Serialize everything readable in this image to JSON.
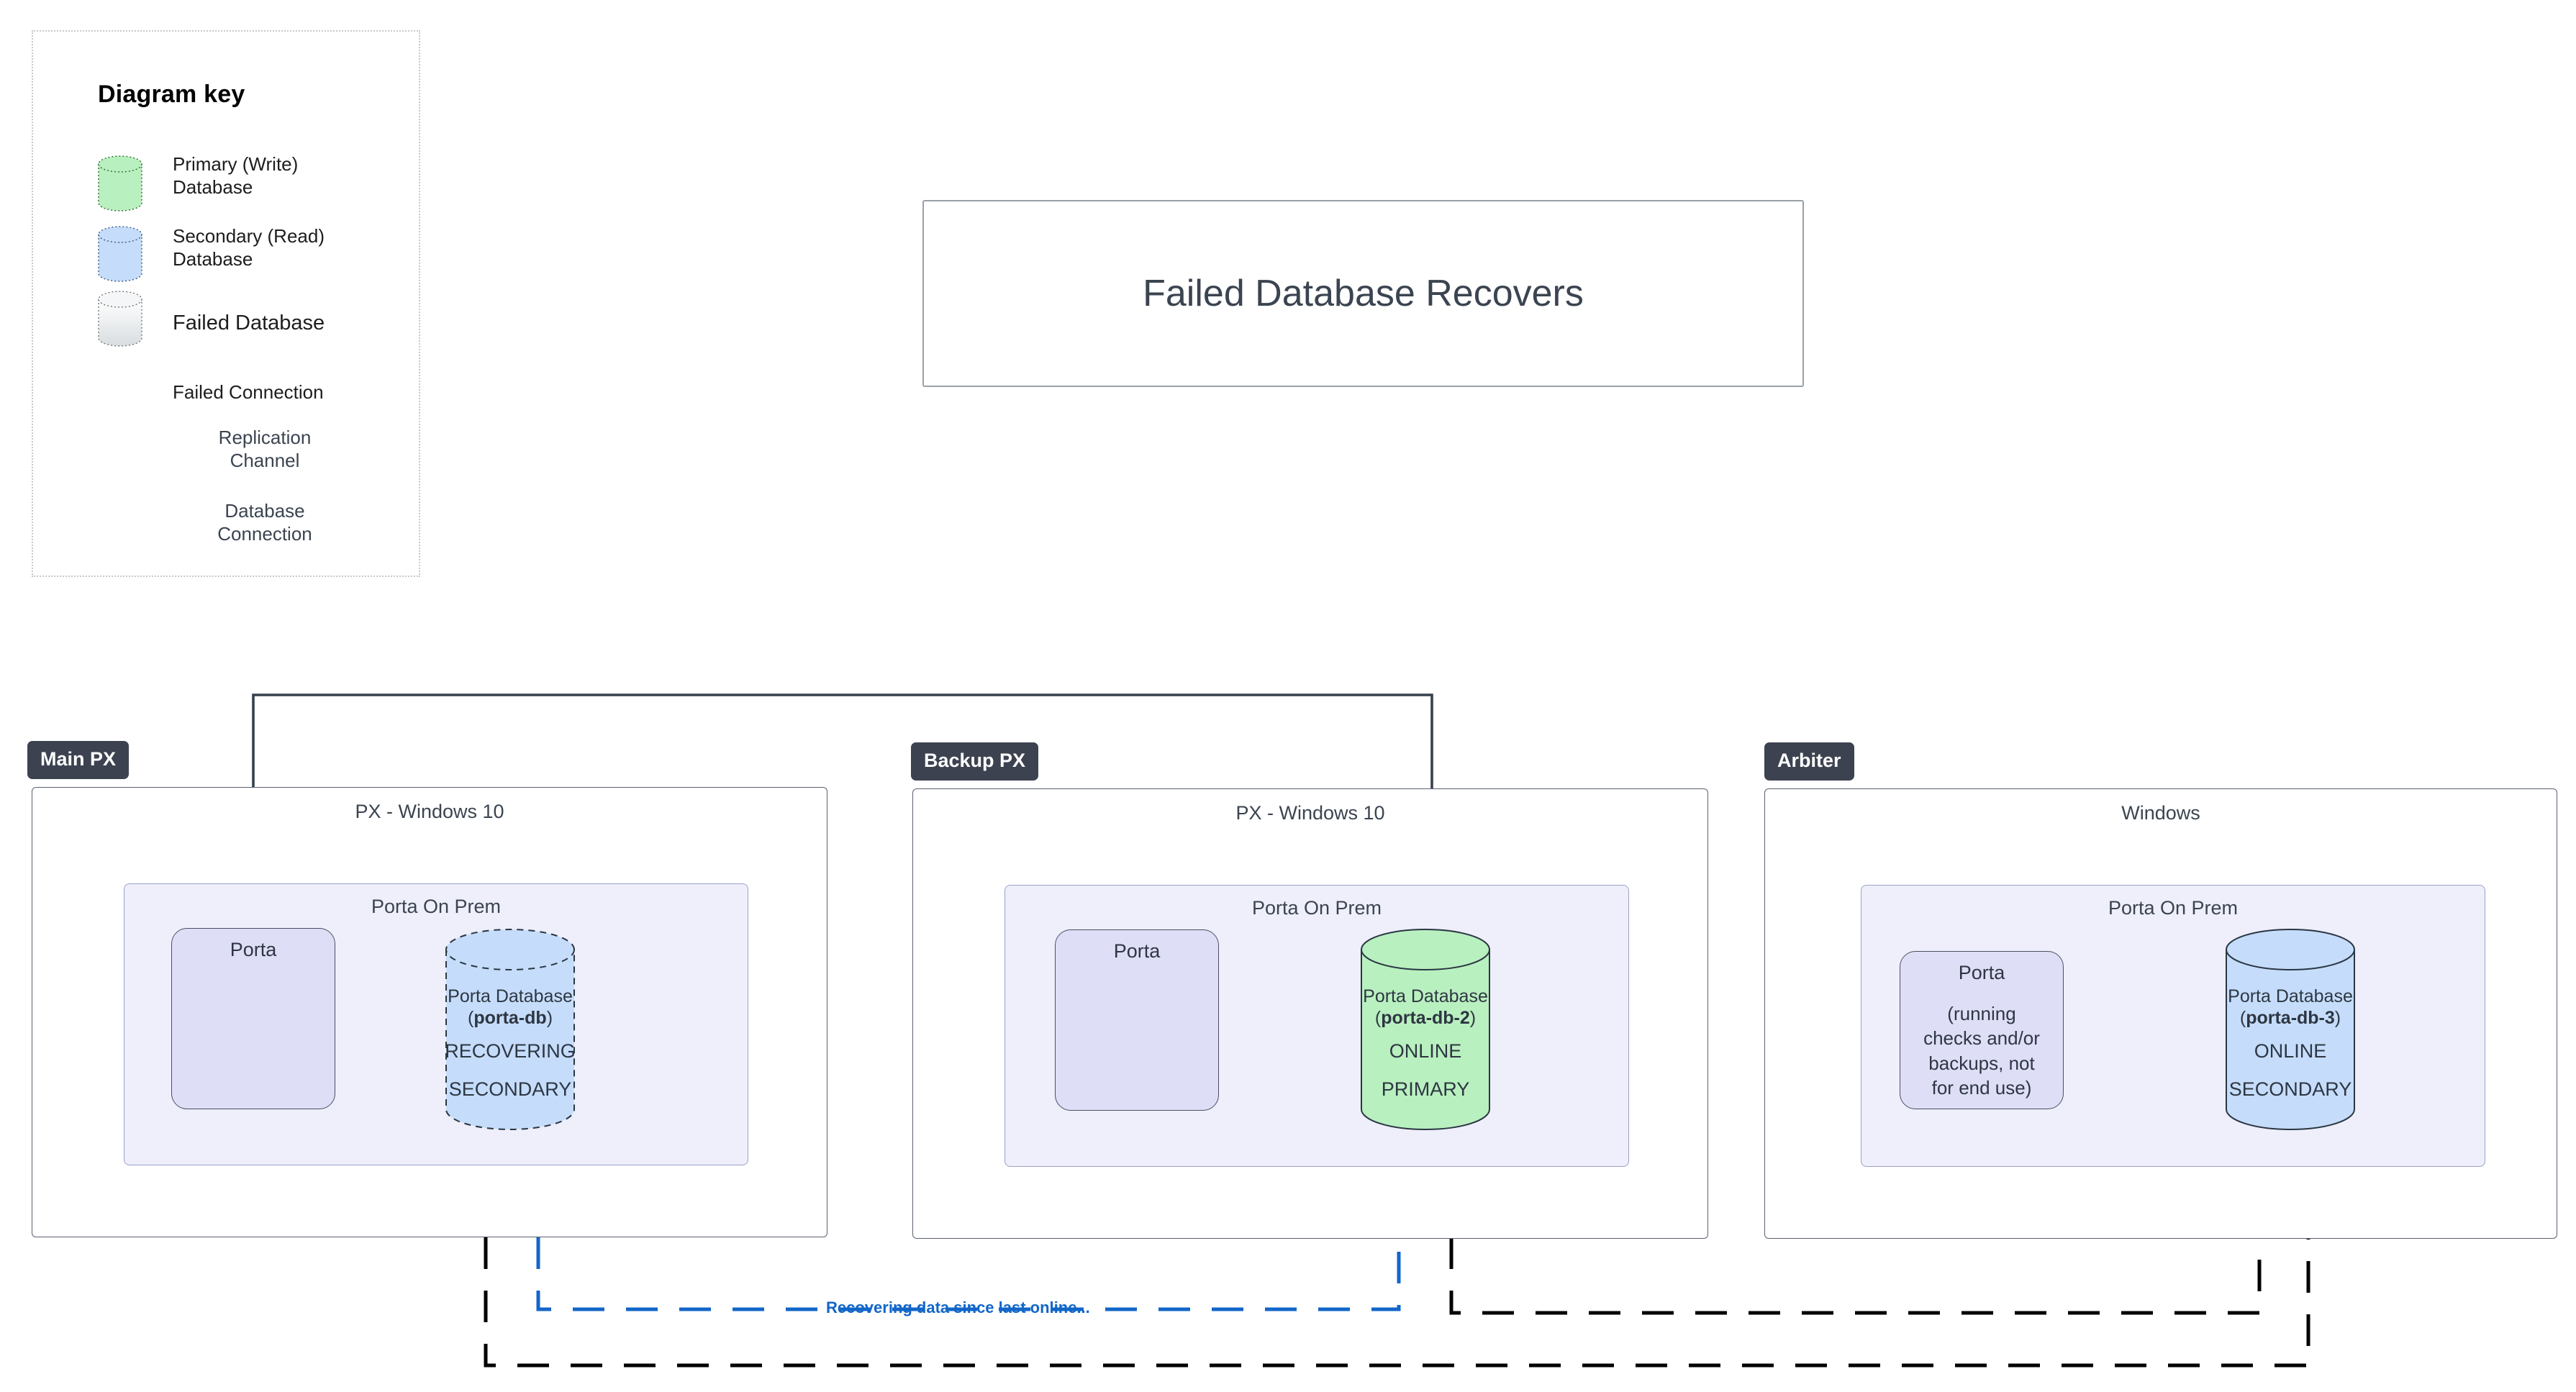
{
  "title_card": {
    "text": "Failed Database Recovers"
  },
  "legend": {
    "title": "Diagram key",
    "items": [
      {
        "icon": "cylinder-green-icon",
        "label": "Primary (Write)\nDatabase",
        "color": "#b9f0bf"
      },
      {
        "icon": "cylinder-blue-icon",
        "label": "Secondary (Read)\nDatabase",
        "color": "#c5ddfa"
      },
      {
        "icon": "cylinder-failed-icon",
        "label": "Failed Database",
        "color": "#e9ebec"
      },
      {
        "icon": "red-x-icon",
        "label": "Failed Connection",
        "color": "#ee0000"
      },
      {
        "icon": "dashed-double-arrow-icon",
        "label": "Replication\nChannel",
        "color": "#36404b"
      },
      {
        "icon": "solid-arrow-icon",
        "label": "Database\nConnection",
        "color": "#36404b"
      }
    ]
  },
  "groups": [
    {
      "badge": "Main PX",
      "host_label": "PX - Windows 10",
      "prem_label": "Porta On Prem",
      "porta": {
        "title": "Porta",
        "sub": ""
      },
      "db": {
        "name": "Porta Database",
        "id": "porta-db",
        "status": "RECOVERING",
        "role": "SECONDARY",
        "fill": "#c5ddfa",
        "style": "dashed"
      }
    },
    {
      "badge": "Backup PX",
      "host_label": "PX - Windows 10",
      "prem_label": "Porta On Prem",
      "porta": {
        "title": "Porta",
        "sub": ""
      },
      "db": {
        "name": "Porta Database",
        "id": "porta-db-2",
        "status": "ONLINE",
        "role": "PRIMARY",
        "fill": "#b9f0bf",
        "style": "solid"
      }
    },
    {
      "badge": "Arbiter",
      "host_label": "Windows",
      "prem_label": "Porta On Prem",
      "porta": {
        "title": "Porta",
        "sub": "(running\nchecks and/or\nbackups, not\nfor end use)"
      },
      "db": {
        "name": "Porta Database",
        "id": "porta-db-3",
        "status": "ONLINE",
        "role": "SECONDARY",
        "fill": "#c5ddfa",
        "style": "solid"
      }
    }
  ],
  "edges": [
    {
      "name": "recovering-replication",
      "label": "Recovering data since last online...",
      "color": "#1266c8"
    }
  ],
  "colors": {
    "badge_bg": "#3c4250",
    "prem_bg": "#eeeffb",
    "porta_bg": "#dedef6",
    "primary_db": "#b9f0bf",
    "secondary_db": "#c5ddfa",
    "failed_db": "#e9ebec",
    "failed_connection": "#ee0000",
    "line": "#000000",
    "replication_blue": "#1266c8"
  }
}
